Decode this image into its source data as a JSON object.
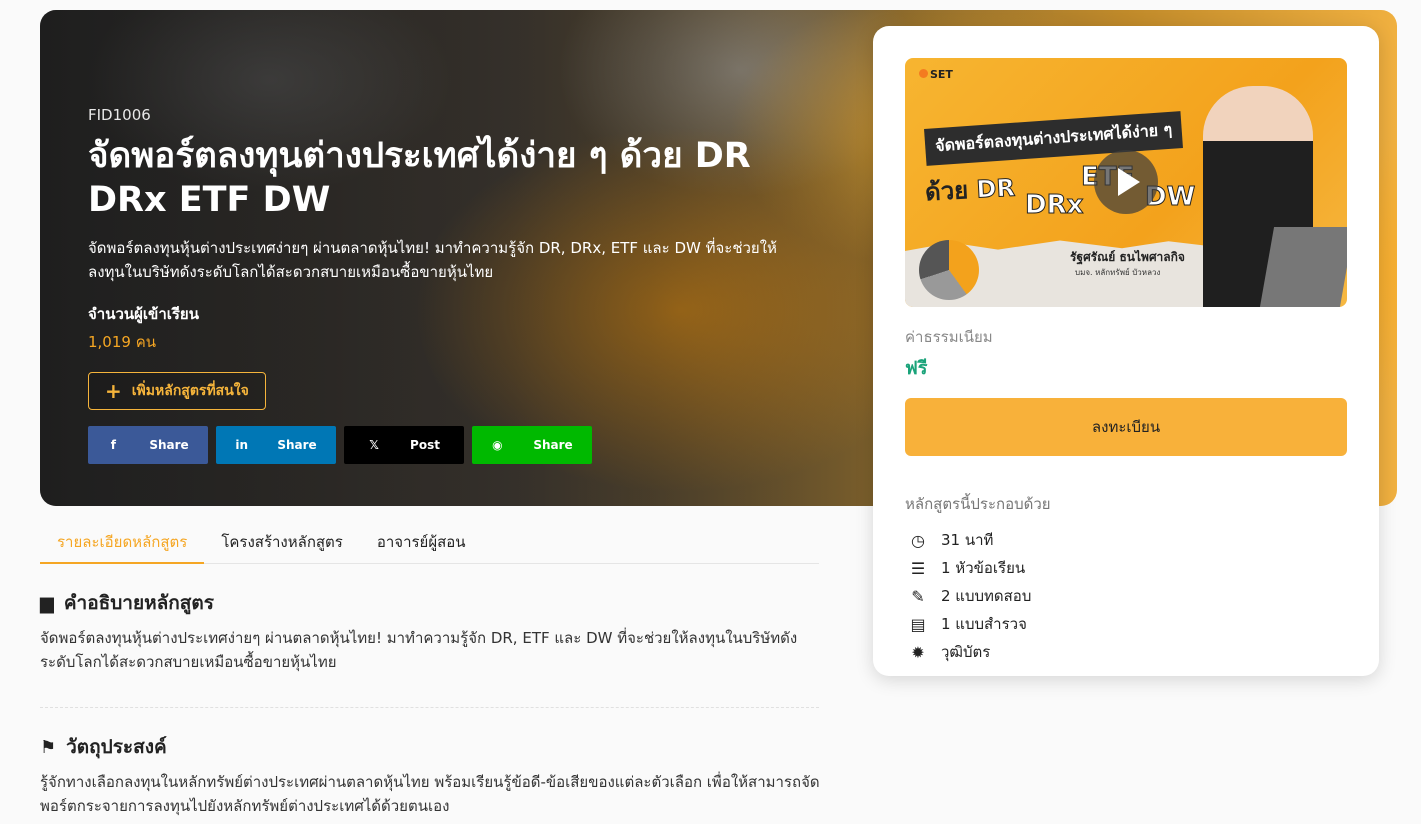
{
  "hero": {
    "code": "FID1006",
    "title": "จัดพอร์ตลงทุนต่างประเทศได้ง่าย ๆ ด้วย DR DRx ETF DW",
    "subtitle": "จัดพอร์ตลงทุนหุ้นต่างประเทศง่ายๆ ผ่านตลาดหุ้นไทย! มาทำความรู้จัก DR, DRx, ETF และ DW ที่จะช่วยให้ลงทุนในบริษัทดังระดับโลกได้สะดวกสบายเหมือนซื้อขายหุ้นไทย",
    "enroll_label": "จำนวนผู้เข้าเรียน",
    "enroll_count": "1,019 คน",
    "add_button": "เพิ่มหลักสูตรที่สนใจ",
    "share": {
      "facebook": "Share",
      "linkedin": "Share",
      "x": "Post",
      "line": "Share"
    }
  },
  "card": {
    "thumbnail": {
      "logo": "SET",
      "banner": "จัดพอร์ตลงทุนต่างประเทศได้ง่าย ๆ",
      "with": "ด้วย",
      "dr": "DR",
      "drx": "DRx",
      "etf": "ETF",
      "dw": "DW",
      "presenter": "รัฐศรัณย์ ธนไพศาลกิจ",
      "presenter_org": "บมจ. หลักทรัพย์ บัวหลวง"
    },
    "fee_label": "ค่าธรรมเนียม",
    "fee_value": "ฟรี",
    "register_button": "ลงทะเบียน",
    "includes_label": "หลักสูตรนี้ประกอบด้วย",
    "includes": [
      {
        "icon": "clock-icon",
        "text": "31 นาที"
      },
      {
        "icon": "list-icon",
        "text": "1 หัวข้อเรียน"
      },
      {
        "icon": "pencil-icon",
        "text": "2 แบบทดสอบ"
      },
      {
        "icon": "chart-icon",
        "text": "1 แบบสำรวจ"
      },
      {
        "icon": "badge-icon",
        "text": "วุฒิบัตร"
      }
    ]
  },
  "tabs": [
    "รายละเอียดหลักสูตร",
    "โครงสร้างหลักสูตร",
    "อาจารย์ผู้สอน"
  ],
  "description": {
    "title": "คำอธิบายหลักสูตร",
    "body": "จัดพอร์ตลงทุนหุ้นต่างประเทศง่ายๆ ผ่านตลาดหุ้นไทย! มาทำความรู้จัก DR, ETF และ DW ที่จะช่วยให้ลงทุนในบริษัทดังระดับโลกได้สะดวกสบายเหมือนซื้อขายหุ้นไทย"
  },
  "objective": {
    "title": "วัตถุประสงค์",
    "body": "รู้จักทางเลือกลงทุนในหลักทรัพย์ต่างประเทศผ่านตลาดหุ้นไทย พร้อมเรียนรู้ข้อดี-ข้อเสียของแต่ละตัวเลือก เพื่อให้สามารถจัดพอร์ตกระจายการลงทุนไปยังหลักทรัพย์ต่างประเทศได้ด้วยตนเอง"
  },
  "colors": {
    "accent": "#f5a623",
    "free": "#1aa37a",
    "register": "#f8b13a"
  }
}
